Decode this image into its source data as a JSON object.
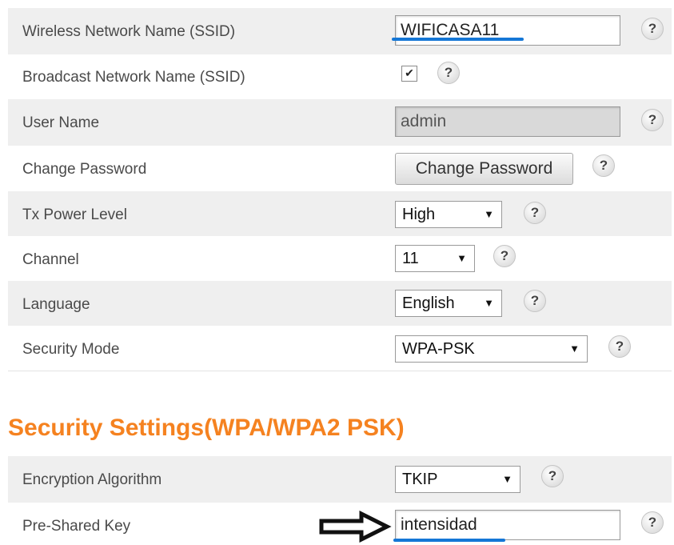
{
  "wireless": {
    "ssid_label": "Wireless Network Name (SSID)",
    "ssid_value": "WIFICASA11",
    "broadcast_label": "Broadcast Network Name (SSID)",
    "broadcast_checked": true,
    "broadcast_mark": "✔",
    "username_label": "User Name",
    "username_value": "admin",
    "change_password_label": "Change Password",
    "change_password_button": "Change Password",
    "tx_power_label": "Tx Power Level",
    "tx_power_value": "High",
    "channel_label": "Channel",
    "channel_value": "11",
    "language_label": "Language",
    "language_value": "English",
    "security_mode_label": "Security Mode",
    "security_mode_value": "WPA-PSK"
  },
  "security": {
    "heading": "Security Settings(WPA/WPA2 PSK)",
    "encryption_label": "Encryption Algorithm",
    "encryption_value": "TKIP",
    "psk_label": "Pre-Shared Key",
    "psk_value": "intensidad"
  },
  "glyphs": {
    "help": "?",
    "dropdown": "▼"
  },
  "annotations": {
    "underline_color": "#1577d6",
    "arrow_icon": "outline-arrow-right-icon"
  },
  "colors": {
    "heading": "#f58220",
    "shaded_row": "#efefef"
  }
}
